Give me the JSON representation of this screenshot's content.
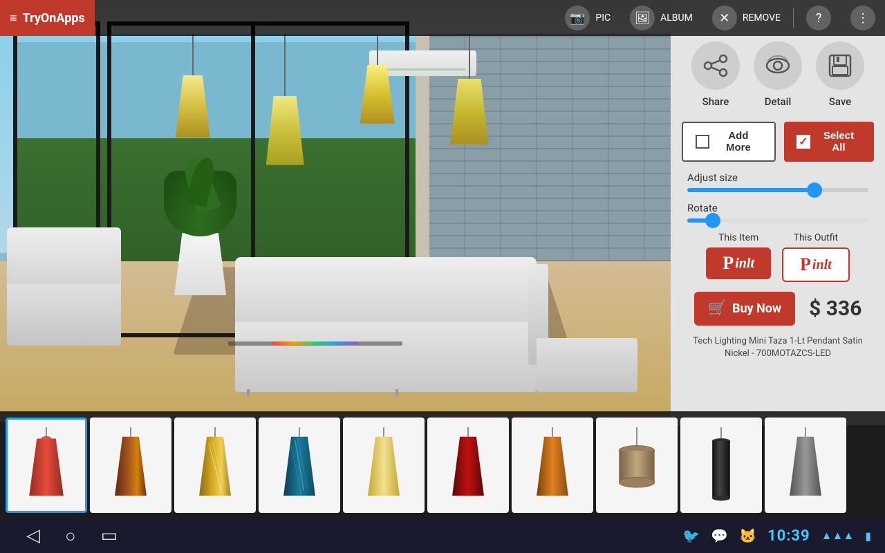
{
  "app": {
    "name": "TryOnApps",
    "logo_icon": "≡"
  },
  "topbar": {
    "pic_label": "PIC",
    "album_label": "ALBUM",
    "remove_label": "REMOVE",
    "help_icon": "?",
    "more_icon": "⋮"
  },
  "panel": {
    "share_label": "Share",
    "detail_label": "Detail",
    "save_label": "Save",
    "add_more_label": "Add More",
    "select_all_label": "Select All",
    "adjust_size_label": "Adjust size",
    "rotate_label": "Rotate",
    "adjust_slider_pct": 68,
    "rotate_slider_pct": 12,
    "this_item_label": "This Item",
    "this_outfit_label": "This Outfit",
    "buy_now_label": "Buy Now",
    "price": "$ 336",
    "product_name": "Tech Lighting Mini Taza 1-Lt Pendant Satin Nickel - 700MOTAZCS-LED"
  },
  "statusbar": {
    "back_icon": "◁",
    "home_icon": "○",
    "recents_icon": "□",
    "twitter_icon": "🐦",
    "chat_icon": "💬",
    "cat_icon": "🐱",
    "time": "10:39",
    "wifi_icon": "📶",
    "battery_icon": "🔋"
  },
  "thumbnails": [
    {
      "id": 1,
      "color_top": "#c0392b",
      "color_mid": "#922b21",
      "type": "cone-red"
    },
    {
      "id": 2,
      "color_top": "#8B4513",
      "color_mid": "#6B3410",
      "type": "cone-brown"
    },
    {
      "id": 3,
      "color_top": "#d4a020",
      "color_mid": "#c49010",
      "type": "cone-gold-swirl"
    },
    {
      "id": 4,
      "color_top": "#1a6688",
      "color_mid": "#144d66",
      "type": "cone-teal-swirl"
    },
    {
      "id": 5,
      "color_top": "#f0e090",
      "color_mid": "#d4c060",
      "type": "cone-cream"
    },
    {
      "id": 6,
      "color_top": "#922b21",
      "color_mid": "#7b241c",
      "type": "cone-dark-red"
    },
    {
      "id": 7,
      "color_top": "#c47820",
      "color_mid": "#a36010",
      "type": "cone-amber"
    },
    {
      "id": 8,
      "color_top": "#8B7355",
      "color_mid": "#7a6248",
      "type": "drum-brown"
    },
    {
      "id": 9,
      "color_top": "#2c2c2c",
      "color_mid": "#1a1a1a",
      "type": "cylinder-black"
    },
    {
      "id": 10,
      "color_top": "#888",
      "color_mid": "#666",
      "type": "cone-gray"
    }
  ]
}
